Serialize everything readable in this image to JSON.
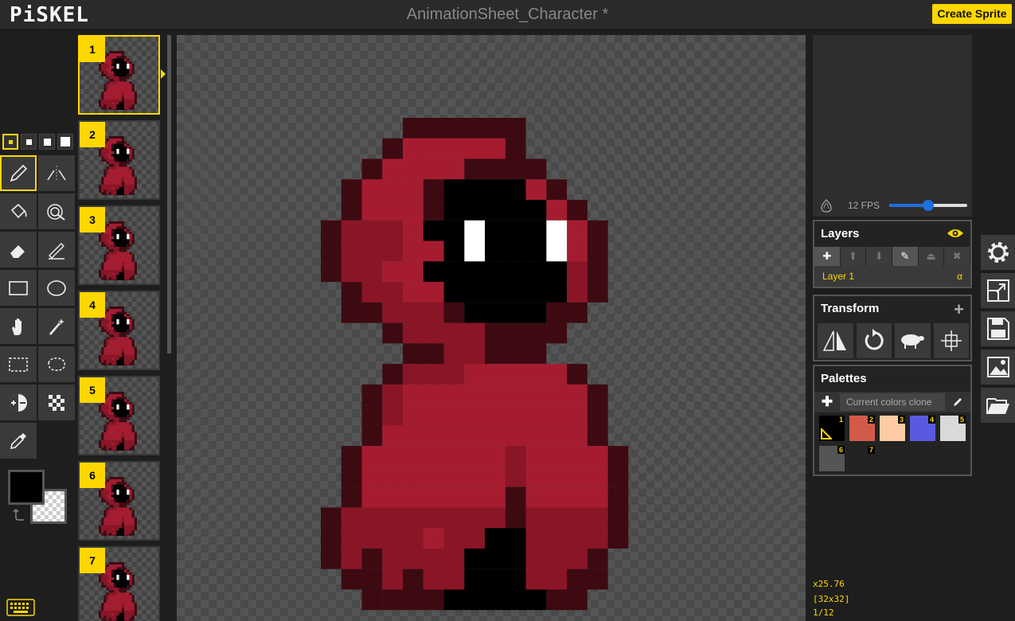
{
  "app": {
    "logo": "PiSKEL",
    "title": "AnimationSheet_Character *",
    "create_button": "Create Sprite"
  },
  "colors": {
    "accent": "#ffd700",
    "cloak_dark": "#3d0a12",
    "cloak_mid": "#8a1526",
    "cloak_light": "#a51c30",
    "void": "#000000",
    "eyes": "#ffffff"
  },
  "pen_sizes": [
    {
      "size": 1,
      "selected": true
    },
    {
      "size": 2
    },
    {
      "size": 3
    },
    {
      "size": 4
    }
  ],
  "tools": [
    {
      "name": "pen-tool",
      "icon": "pen-icon",
      "selected": true
    },
    {
      "name": "vertical-mirror-pen-tool",
      "icon": "mirror-pen-icon"
    },
    {
      "name": "paint-bucket-tool",
      "icon": "bucket-icon"
    },
    {
      "name": "paint-same-color-tool",
      "icon": "same-color-bucket-icon"
    },
    {
      "name": "eraser-tool",
      "icon": "eraser-icon"
    },
    {
      "name": "stroke-tool",
      "icon": "stroke-icon"
    },
    {
      "name": "rectangle-tool",
      "icon": "rectangle-icon"
    },
    {
      "name": "circle-tool",
      "icon": "circle-icon"
    },
    {
      "name": "move-tool",
      "icon": "hand-icon"
    },
    {
      "name": "shape-select-tool",
      "icon": "magic-wand-icon"
    },
    {
      "name": "rectangle-select-tool",
      "icon": "rect-select-icon"
    },
    {
      "name": "lasso-select-tool",
      "icon": "lasso-icon"
    },
    {
      "name": "lighten-tool",
      "icon": "lighten-icon"
    },
    {
      "name": "dithering-tool",
      "icon": "dither-icon"
    },
    {
      "name": "color-picker-tool",
      "icon": "eyedropper-icon"
    }
  ],
  "primary_color": "#000000",
  "frames": [
    {
      "label": "1",
      "selected": true
    },
    {
      "label": "2"
    },
    {
      "label": "3"
    },
    {
      "label": "4"
    },
    {
      "label": "5"
    },
    {
      "label": "6"
    },
    {
      "label": "7"
    }
  ],
  "preview": {
    "fps_label": "12 FPS",
    "fps": 12,
    "fps_max": 24
  },
  "layers": {
    "title": "Layers",
    "items": [
      {
        "name": "Layer 1",
        "alpha": "α"
      }
    ]
  },
  "transform": {
    "title": "Transform",
    "actions": [
      "flip-icon",
      "rotate-icon",
      "sheep-icon",
      "align-center-icon"
    ]
  },
  "palettes": {
    "title": "Palettes",
    "selected": "Current colors clone",
    "colors": [
      {
        "hex": "#000000",
        "index": "1"
      },
      {
        "hex": "#d35a4a",
        "index": "2"
      },
      {
        "hex": "#ffcba4",
        "index": "3"
      },
      {
        "hex": "#5a5ae0",
        "index": "4"
      },
      {
        "hex": "#d9d9d9",
        "index": "5"
      },
      {
        "hex": "#555555",
        "index": "6"
      },
      {
        "hex": "#232323",
        "index": "7"
      }
    ]
  },
  "status": {
    "zoom": "x25.76",
    "size": "[32x32]",
    "frame": "1/12"
  },
  "side_actions": [
    "settings-icon",
    "resize-icon",
    "save-icon",
    "export-image-icon",
    "open-folder-icon"
  ]
}
